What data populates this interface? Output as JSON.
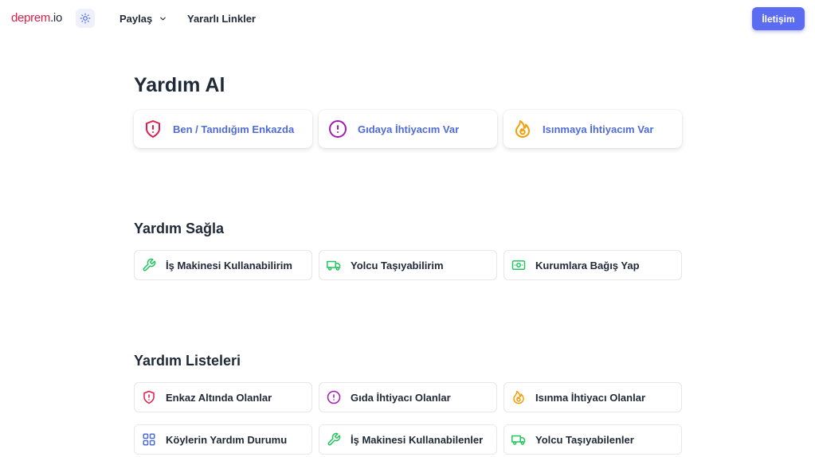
{
  "header": {
    "logo_brand": "deprem",
    "logo_tld": ".io",
    "share_label": "Paylaş",
    "links_label": "Yararlı Linkler",
    "contact_label": "İletişim"
  },
  "get_help": {
    "title": "Yardım Al",
    "cards": [
      {
        "label": "Ben / Tanıdığım Enkazda",
        "icon": "shield-alert-icon",
        "color": "#e11d48"
      },
      {
        "label": "Gıdaya İhtiyacım Var",
        "icon": "alert-circle-icon",
        "color": "#a21caf"
      },
      {
        "label": "Isınmaya İhtiyacım Var",
        "icon": "flame-icon",
        "color": "#f59e0b"
      }
    ]
  },
  "give_help": {
    "title": "Yardım Sağla",
    "cards": [
      {
        "label": "İş Makinesi Kullanabilirim",
        "icon": "wrench-icon",
        "color": "#22c55e"
      },
      {
        "label": "Yolcu Taşıyabilirim",
        "icon": "truck-icon",
        "color": "#22c55e"
      },
      {
        "label": "Kurumlara Bağış Yap",
        "icon": "banknote-icon",
        "color": "#22c55e"
      }
    ]
  },
  "help_lists": {
    "title": "Yardım Listeleri",
    "cards": [
      {
        "label": "Enkaz Altında Olanlar",
        "icon": "shield-alert-icon",
        "color": "#e11d48"
      },
      {
        "label": "Gıda İhtiyacı Olanlar",
        "icon": "alert-circle-icon",
        "color": "#a21caf"
      },
      {
        "label": "Isınma İhtiyacı Olanlar",
        "icon": "flame-icon",
        "color": "#f59e0b"
      },
      {
        "label": "Köylerin Yardım Durumu",
        "icon": "grid-icon",
        "color": "#4f6bd8"
      },
      {
        "label": "İş Makinesi Kullanabilenler",
        "icon": "wrench-icon",
        "color": "#22c55e"
      },
      {
        "label": "Yolcu Taşıyabilenler",
        "icon": "truck-icon",
        "color": "#22c55e"
      }
    ]
  },
  "colors": {
    "accent": "#5b6cf0",
    "link_blue": "#4f6bd8",
    "brand_red": "#e11d48"
  }
}
